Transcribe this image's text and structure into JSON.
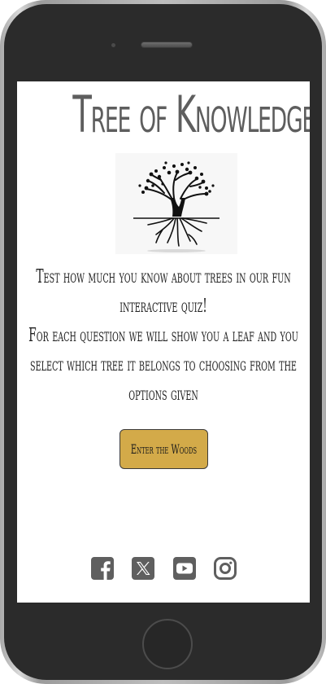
{
  "app": {
    "title": "Tree of Knowledge"
  },
  "intro": {
    "line1": "Test how much you know about trees in our fun interactive quiz!",
    "line2": "For each question we will show you a leaf and you select which tree it belongs to choosing from the options given"
  },
  "cta": {
    "label": "Enter the Woods"
  },
  "social": [
    {
      "icon": "facebook-icon"
    },
    {
      "icon": "x-twitter-icon"
    },
    {
      "icon": "youtube-icon"
    },
    {
      "icon": "instagram-icon"
    }
  ],
  "colors": {
    "button_bg": "#d3aa49",
    "title_text": "#5e5e5e",
    "icon": "#5f5f5f"
  }
}
